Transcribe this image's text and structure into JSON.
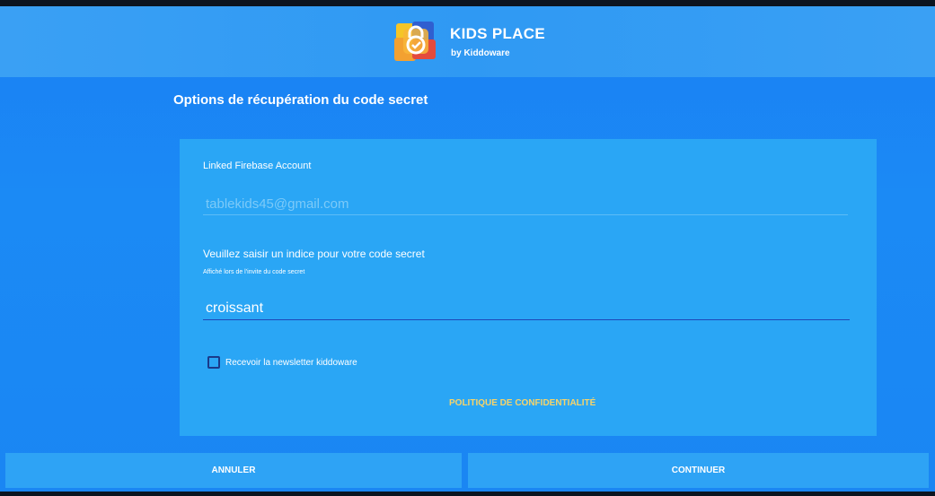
{
  "header": {
    "app_name": "KIDS PLACE",
    "subtitle": "by Kiddoware",
    "logo_icon": "kids-place-lock-logo"
  },
  "page": {
    "title": "Options de récupération du code secret"
  },
  "firebase": {
    "label": "Linked Firebase Account",
    "placeholder": "tablekids45@gmail.com"
  },
  "hint": {
    "label": "Veuillez saisir un indice pour votre code secret",
    "sublabel": "Affiché lors de l'invite du code secret",
    "value": "croissant"
  },
  "newsletter": {
    "label": "Recevoir la newsletter kiddoware",
    "checked": false
  },
  "privacy": {
    "label": "POLITIQUE DE CONFIDENTIALITÉ"
  },
  "actions": {
    "cancel_label": "ANNULER",
    "continue_label": "CONTINUER"
  },
  "colors": {
    "background": "#1a86f3",
    "card": "#2aa6f5",
    "link": "#f7d46a"
  }
}
